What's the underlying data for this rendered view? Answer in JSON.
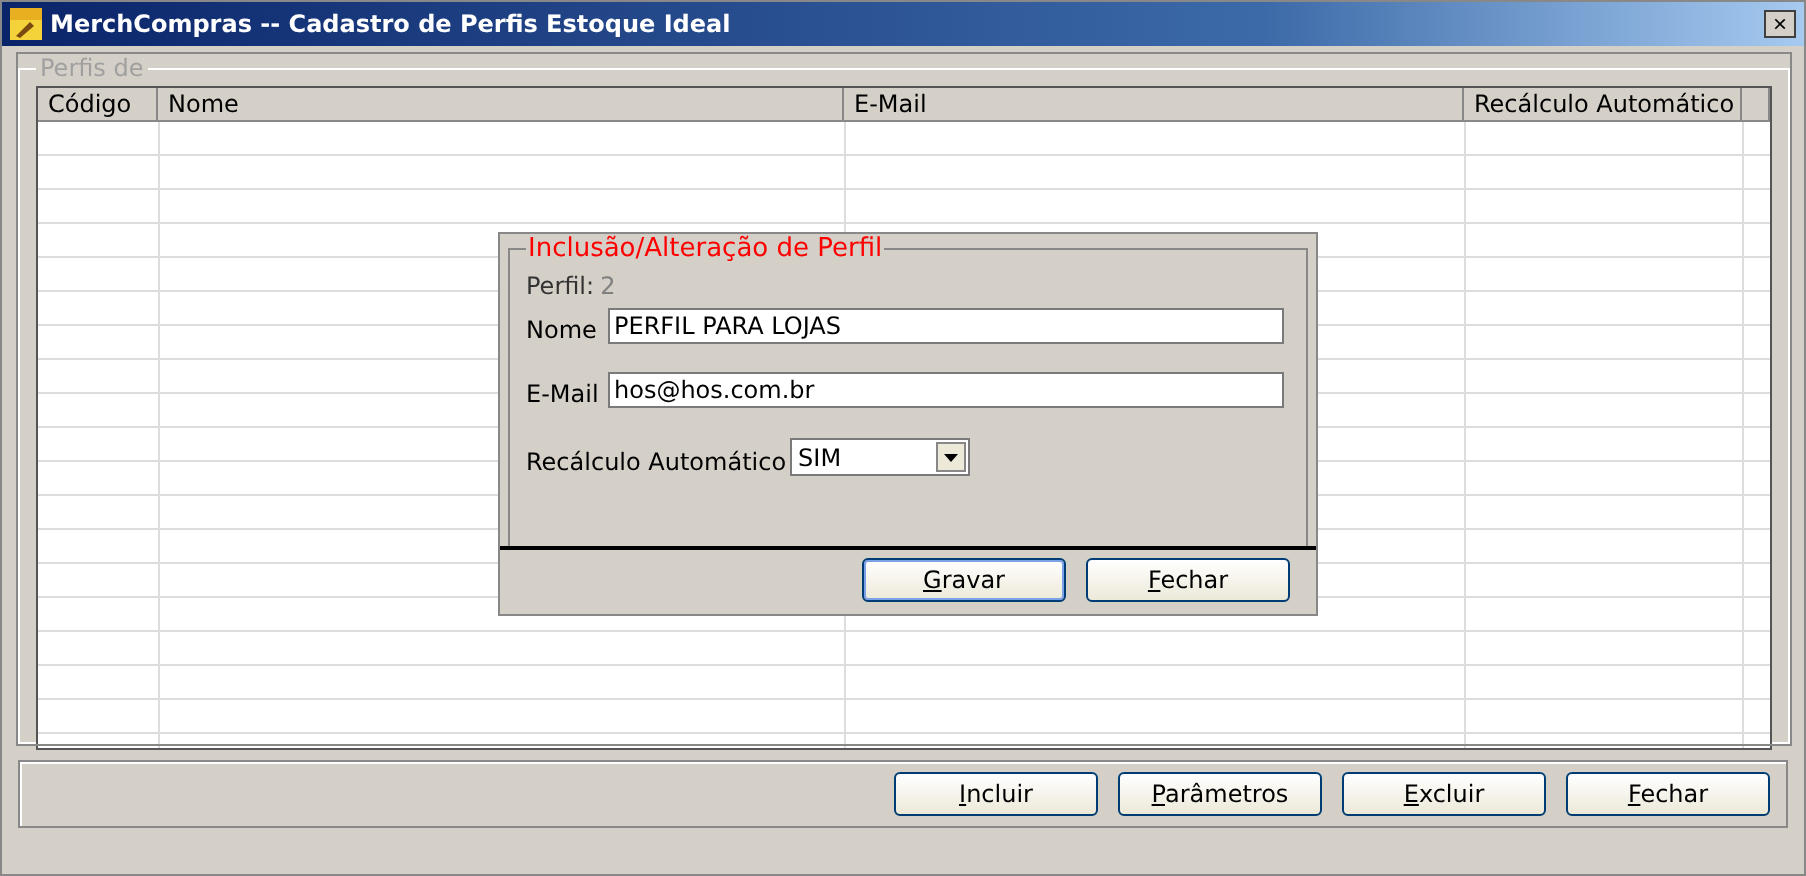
{
  "window": {
    "title": "MerchCompras -- Cadastro de Perfis Estoque Ideal",
    "close": "×"
  },
  "group": {
    "title": "Perfis de"
  },
  "table": {
    "columns": [
      "Código",
      "Nome",
      "E-Mail",
      "Recálculo Automático"
    ]
  },
  "dialog": {
    "title": "Inclusão/Alteração de Perfil",
    "perfil_label": "Perfil:",
    "perfil_value": "2",
    "fields": [
      {
        "label": "Nome",
        "value": "PERFIL PARA LOJAS"
      },
      {
        "label": "E-Mail",
        "value": "hos@hos.com.br"
      }
    ],
    "recalc": {
      "label": "Recálculo Automático",
      "value": "SIM"
    },
    "buttons": [
      {
        "label": "Gravar",
        "default": true
      },
      {
        "label": "Fechar",
        "default": false
      }
    ]
  },
  "buttons": [
    "Incluir",
    "Parâmetros",
    "Excluir",
    "Fechar"
  ]
}
